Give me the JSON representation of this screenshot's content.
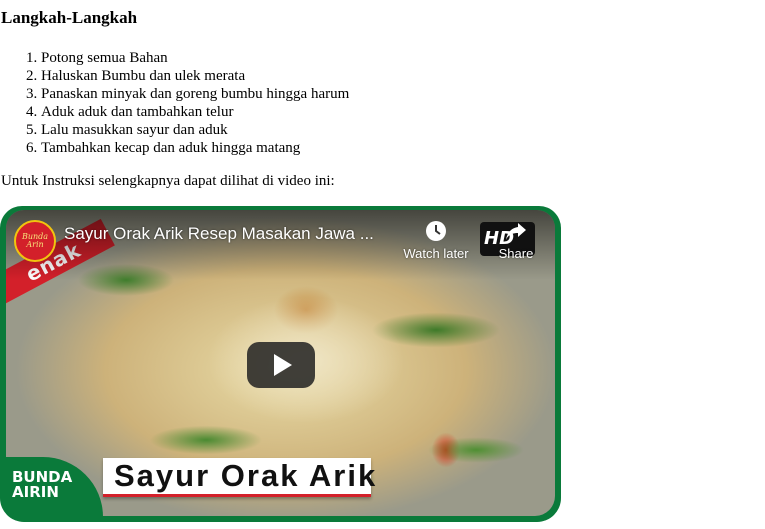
{
  "section": {
    "heading": "Langkah-Langkah",
    "steps": [
      "Potong semua Bahan",
      "Haluskan Bumbu dan ulek merata",
      "Panaskan minyak dan goreng bumbu hingga harum",
      "Aduk aduk dan tambahkan telur",
      "Lalu masukkan sayur dan aduk",
      "Tambahkan kecap dan aduk hingga matang"
    ],
    "intro": "Untuk Instruksi selengkapnya dapat dilihat di video ini:"
  },
  "video": {
    "title": "Sayur Orak Arik Resep Masakan Jawa ...",
    "watch_later_label": "Watch later",
    "share_label": "Share",
    "hd_label": "HD",
    "channel_logo_text": "Bunda Arin",
    "corner_text": "enak",
    "brand_text_line1": "BUNDA",
    "brand_text_line2": "AIRIN",
    "banner_text": "Sayur Orak Arik",
    "colors": {
      "frame": "#0a7a3a",
      "accent_red": "#d3202a"
    }
  }
}
